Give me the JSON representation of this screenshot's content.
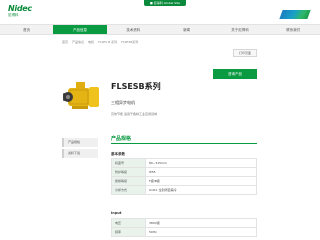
{
  "header": {
    "logo_text": "Nidec",
    "logo_sub": "尼得科",
    "top_link": "■ 尼得科 Global Site"
  },
  "nav": {
    "items": [
      {
        "label": "首页",
        "active": false
      },
      {
        "label": "产品信息",
        "active": true
      },
      {
        "label": "技术资料",
        "active": false
      },
      {
        "label": "新闻",
        "active": false
      },
      {
        "label": "关于尼得科",
        "active": false
      },
      {
        "label": "联系我们",
        "active": false
      }
    ]
  },
  "breadcrumb": [
    "首页",
    "产品信息",
    "电机",
    "FLSES B 系列",
    "FLSESB系列"
  ],
  "tools": {
    "label": "打印页面"
  },
  "product": {
    "title": "FLSESB系列",
    "subtitle": "三相异步电机",
    "description": "高效节能 适用于各种工业应用领域",
    "cta": "咨询产品"
  },
  "side_menu": {
    "items": [
      "产品规格",
      "资料下载"
    ]
  },
  "specs": {
    "section_title": "产品规格",
    "groups": [
      {
        "title": "基本参数",
        "rows": [
          {
            "key": "机座号",
            "value": "80~315mm"
          },
          {
            "key": "防护等级",
            "value": "IP55"
          },
          {
            "key": "绝缘等级",
            "value": "F级/B级"
          },
          {
            "key": "冷却方式",
            "value": "IC411 全封闭自扇冷"
          }
        ]
      },
      {
        "title": "Input",
        "rows": [
          {
            "key": "电压",
            "value": "380V级"
          },
          {
            "key": "频率",
            "value": "50Hz"
          }
        ]
      }
    ]
  }
}
